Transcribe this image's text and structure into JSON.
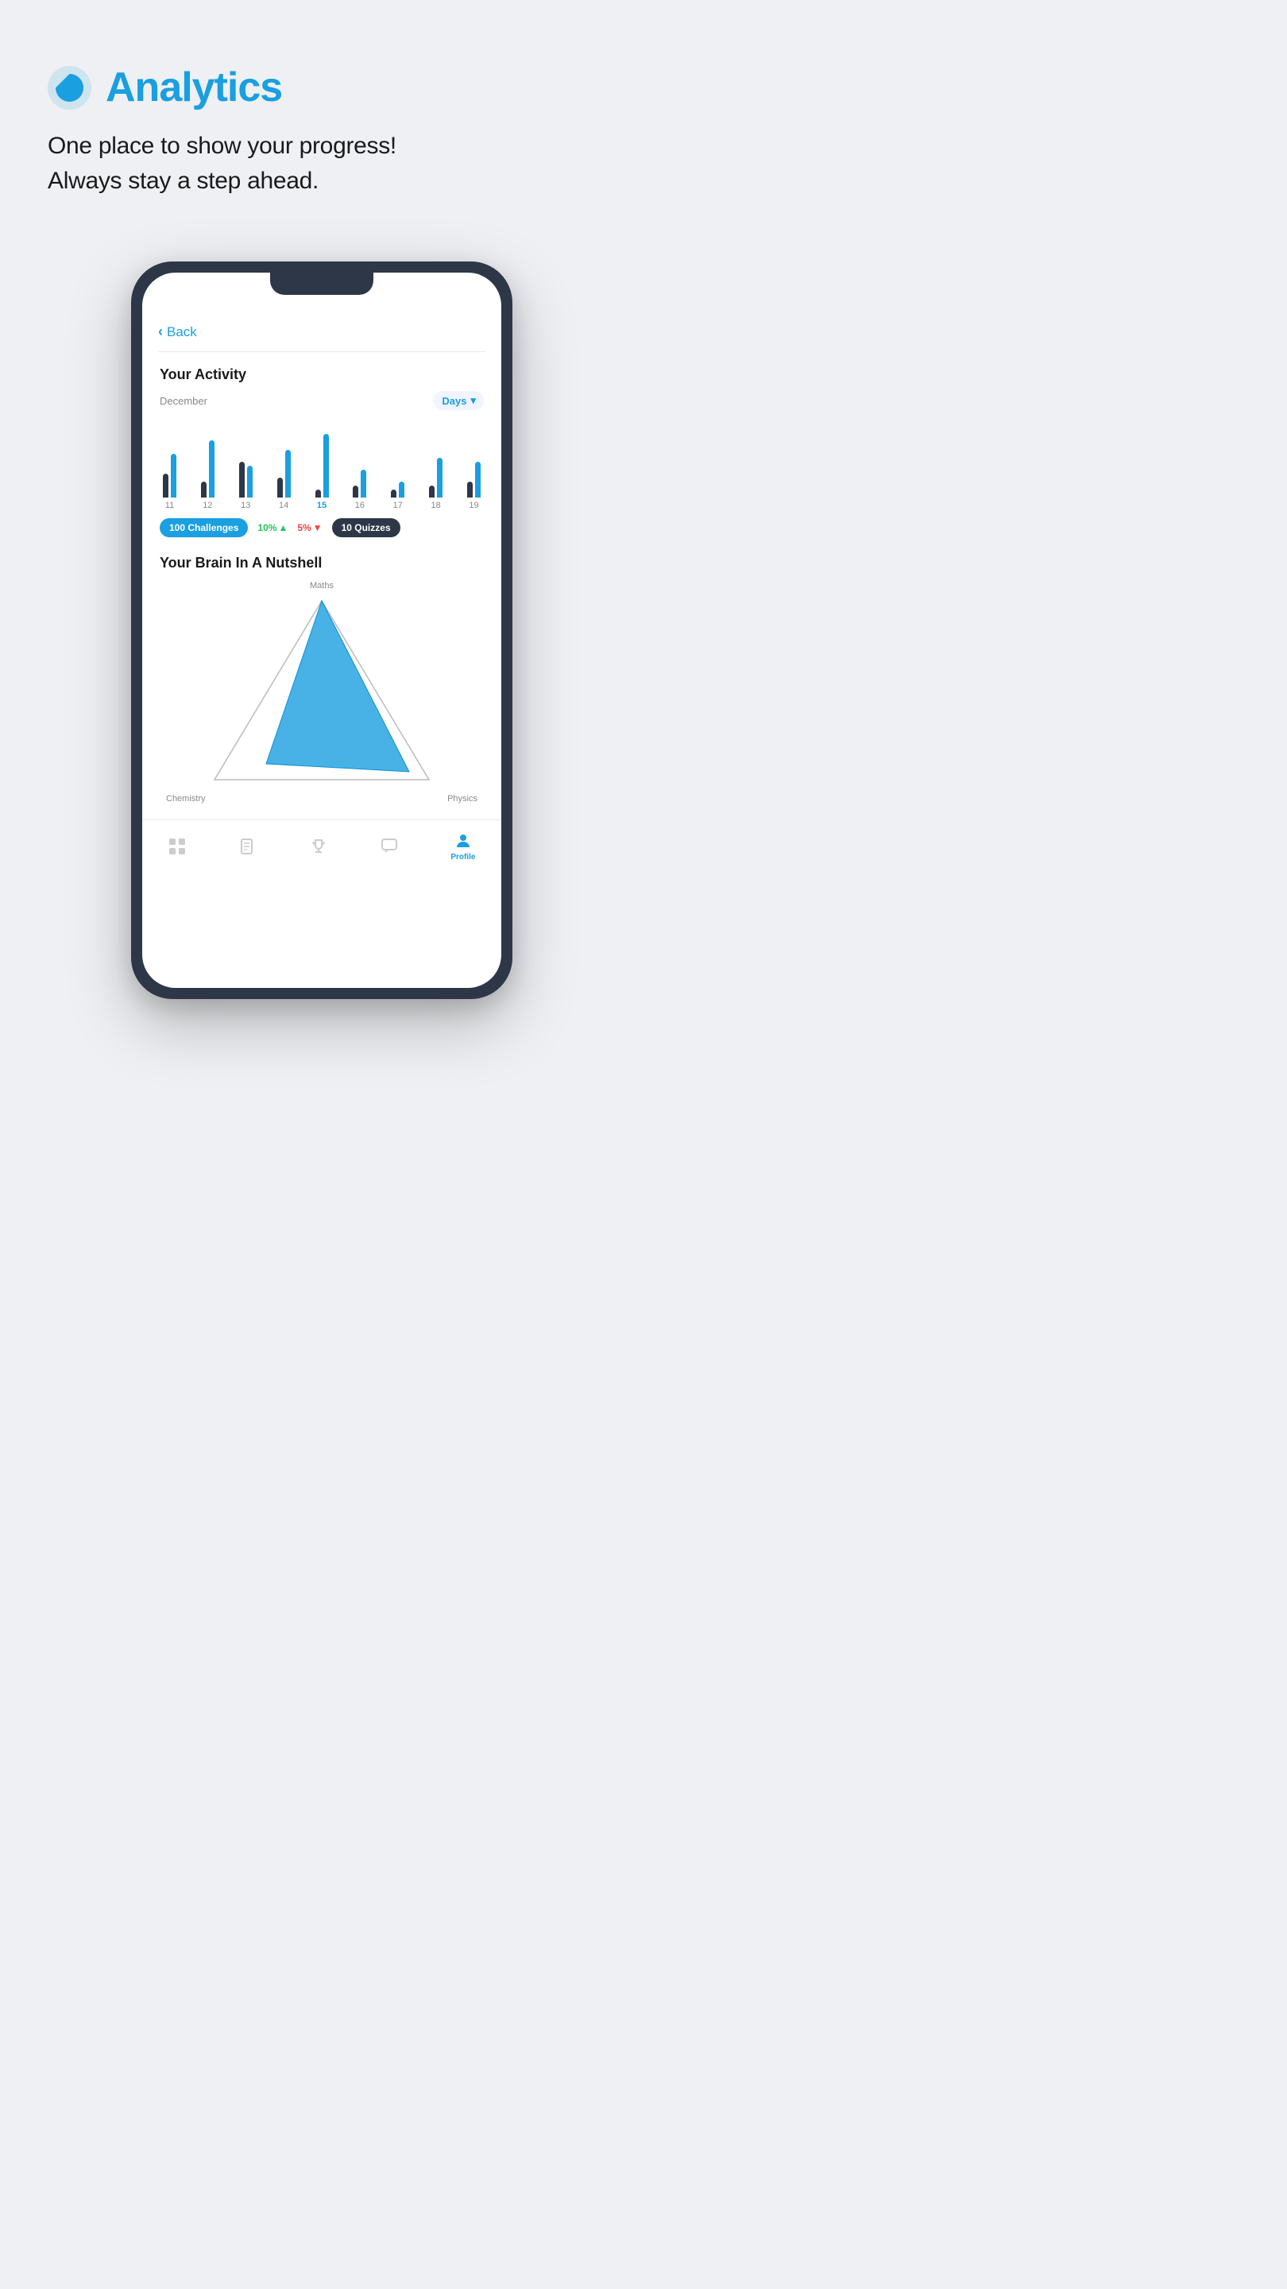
{
  "page": {
    "background_color": "#eef0f3"
  },
  "header": {
    "icon_label": "analytics-pie-icon",
    "title": "Analytics",
    "subtitle_line1": "One place to show your progress!",
    "subtitle_line2": "Always stay a step ahead."
  },
  "phone": {
    "back_button": "Back",
    "activity": {
      "title": "Your Activity",
      "month": "December",
      "filter": "Days",
      "bars": [
        {
          "day": "11",
          "blue_height": 55,
          "dark_height": 30,
          "active": false
        },
        {
          "day": "12",
          "blue_height": 72,
          "dark_height": 20,
          "active": false
        },
        {
          "day": "13",
          "blue_height": 40,
          "dark_height": 45,
          "active": false
        },
        {
          "day": "14",
          "blue_height": 60,
          "dark_height": 25,
          "active": false
        },
        {
          "day": "15",
          "blue_height": 80,
          "dark_height": 10,
          "active": true
        },
        {
          "day": "16",
          "blue_height": 35,
          "dark_height": 15,
          "active": false
        },
        {
          "day": "17",
          "blue_height": 20,
          "dark_height": 10,
          "active": false
        },
        {
          "day": "18",
          "blue_height": 50,
          "dark_height": 15,
          "active": false
        },
        {
          "day": "19",
          "blue_height": 45,
          "dark_height": 20,
          "active": false
        }
      ],
      "challenges_count": "100",
      "challenges_label": "Challenges",
      "stat_green_value": "10%",
      "stat_red_value": "5%",
      "quizzes_count": "10",
      "quizzes_label": "Quizzes"
    },
    "brain": {
      "title": "Your Brain In A Nutshell",
      "label_maths": "Maths",
      "label_chemistry": "Chemistry",
      "label_physics": "Physics"
    },
    "nav": {
      "items": [
        {
          "id": "dashboard",
          "label": "",
          "active": false
        },
        {
          "id": "book",
          "label": "",
          "active": false
        },
        {
          "id": "trophy",
          "label": "",
          "active": false
        },
        {
          "id": "chat",
          "label": "",
          "active": false
        },
        {
          "id": "profile",
          "label": "Profile",
          "active": true
        }
      ]
    }
  }
}
